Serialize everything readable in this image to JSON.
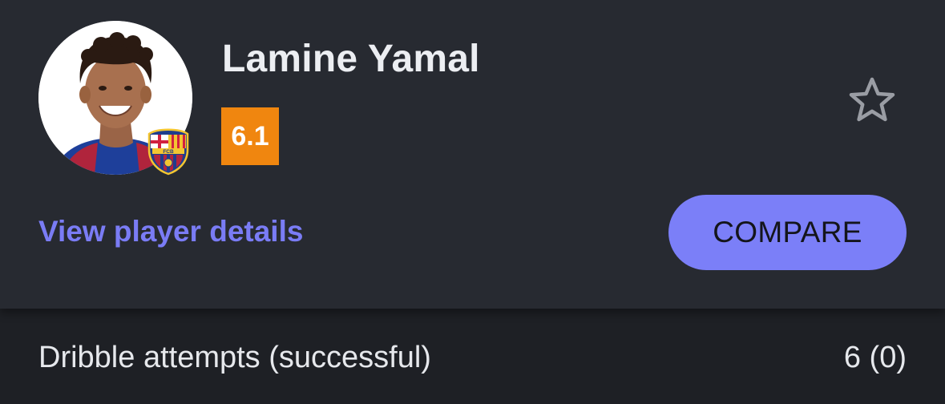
{
  "player": {
    "name": "Lamine Yamal",
    "rating": "6.1",
    "avatar_icon": "player-photo",
    "club_icon": "fc-barcelona-crest",
    "club_crest_text": "FCB"
  },
  "actions": {
    "details_link": "View player details",
    "compare_label": "COMPARE",
    "favorite_icon": "star-outline-icon"
  },
  "stats": [
    {
      "label": "Dribble attempts (successful)",
      "value": "6 (0)"
    }
  ],
  "colors": {
    "background": "#1e2025",
    "card": "#272a31",
    "rating": "#f0860f",
    "accent": "#7b7ff8",
    "link": "#7a7cf5"
  }
}
